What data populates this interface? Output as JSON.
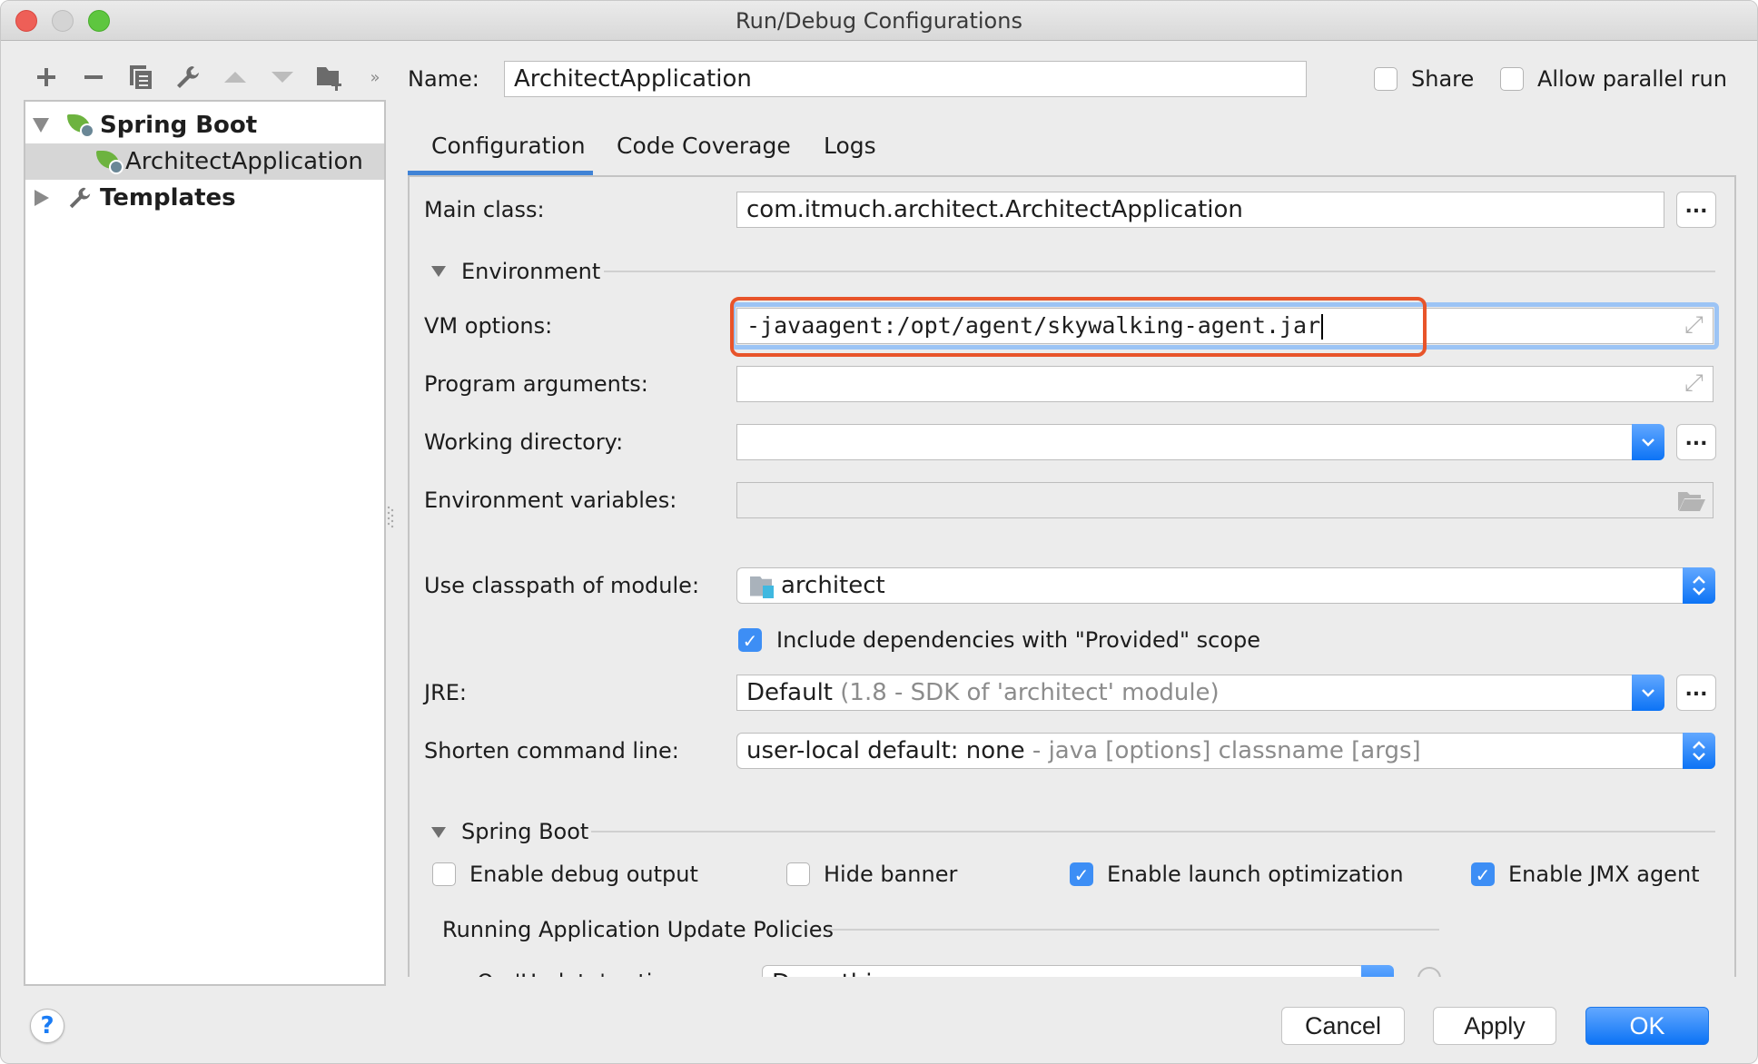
{
  "window": {
    "title": "Run/Debug Configurations"
  },
  "toolbar": {
    "icons": [
      "add-icon",
      "remove-icon",
      "copy-icon",
      "wrench-icon",
      "move-up-icon",
      "move-down-icon",
      "new-folder-icon",
      "more-icon"
    ]
  },
  "tree": {
    "items": [
      {
        "label": "Spring Boot",
        "expanded": true,
        "level": 0,
        "icon": "spring-boot-icon"
      },
      {
        "label": "ArchitectApplication",
        "selected": true,
        "level": 1,
        "icon": "spring-boot-icon"
      },
      {
        "label": "Templates",
        "expanded": false,
        "level": 0,
        "icon": "wrench-icon"
      }
    ]
  },
  "header": {
    "name_label": "Name:",
    "name_value": "ArchitectApplication",
    "share_label": "Share",
    "share_checked": false,
    "parallel_label": "Allow parallel run",
    "parallel_checked": false
  },
  "tabs": [
    {
      "label": "Configuration",
      "active": true
    },
    {
      "label": "Code Coverage",
      "active": false
    },
    {
      "label": "Logs",
      "active": false
    }
  ],
  "config": {
    "main_class_label": "Main class:",
    "main_class_value": "com.itmuch.architect.ArchitectApplication",
    "browse_label": "...",
    "environment_header": "Environment",
    "vm_options_label": "VM options:",
    "vm_options_value": "-javaagent:/opt/agent/skywalking-agent.jar",
    "program_args_label": "Program arguments:",
    "program_args_value": "",
    "working_dir_label": "Working directory:",
    "working_dir_value": "",
    "env_vars_label": "Environment variables:",
    "env_vars_value": "",
    "classpath_label": "Use classpath of module:",
    "classpath_value": "architect",
    "include_deps_label": "Include dependencies with \"Provided\" scope",
    "include_deps_checked": true,
    "jre_label": "JRE:",
    "jre_value": "Default",
    "jre_hint": "(1.8 - SDK of 'architect' module)",
    "shorten_label": "Shorten command line:",
    "shorten_value": "user-local default: none",
    "shorten_hint": "- java [options] classname [args]",
    "spring_boot_header": "Spring Boot",
    "debug_output_label": "Enable debug output",
    "debug_output_checked": false,
    "hide_banner_label": "Hide banner",
    "hide_banner_checked": false,
    "launch_opt_label": "Enable launch optimization",
    "launch_opt_checked": true,
    "jmx_label": "Enable JMX agent",
    "jmx_checked": true,
    "update_policies_header": "Running Application Update Policies",
    "update_action_label": "On 'Update' action:",
    "update_action_value": "Do nothing"
  },
  "highlight": {
    "color": "#e8542a",
    "target": "vm-options-field"
  },
  "footer": {
    "help_label": "?",
    "cancel_label": "Cancel",
    "apply_label": "Apply",
    "ok_label": "OK"
  },
  "colors": {
    "accent": "#0c73f5",
    "tab_underline": "#4083d6",
    "focus_ring": "#9cc4f5",
    "spring_green": "#6db33f"
  }
}
